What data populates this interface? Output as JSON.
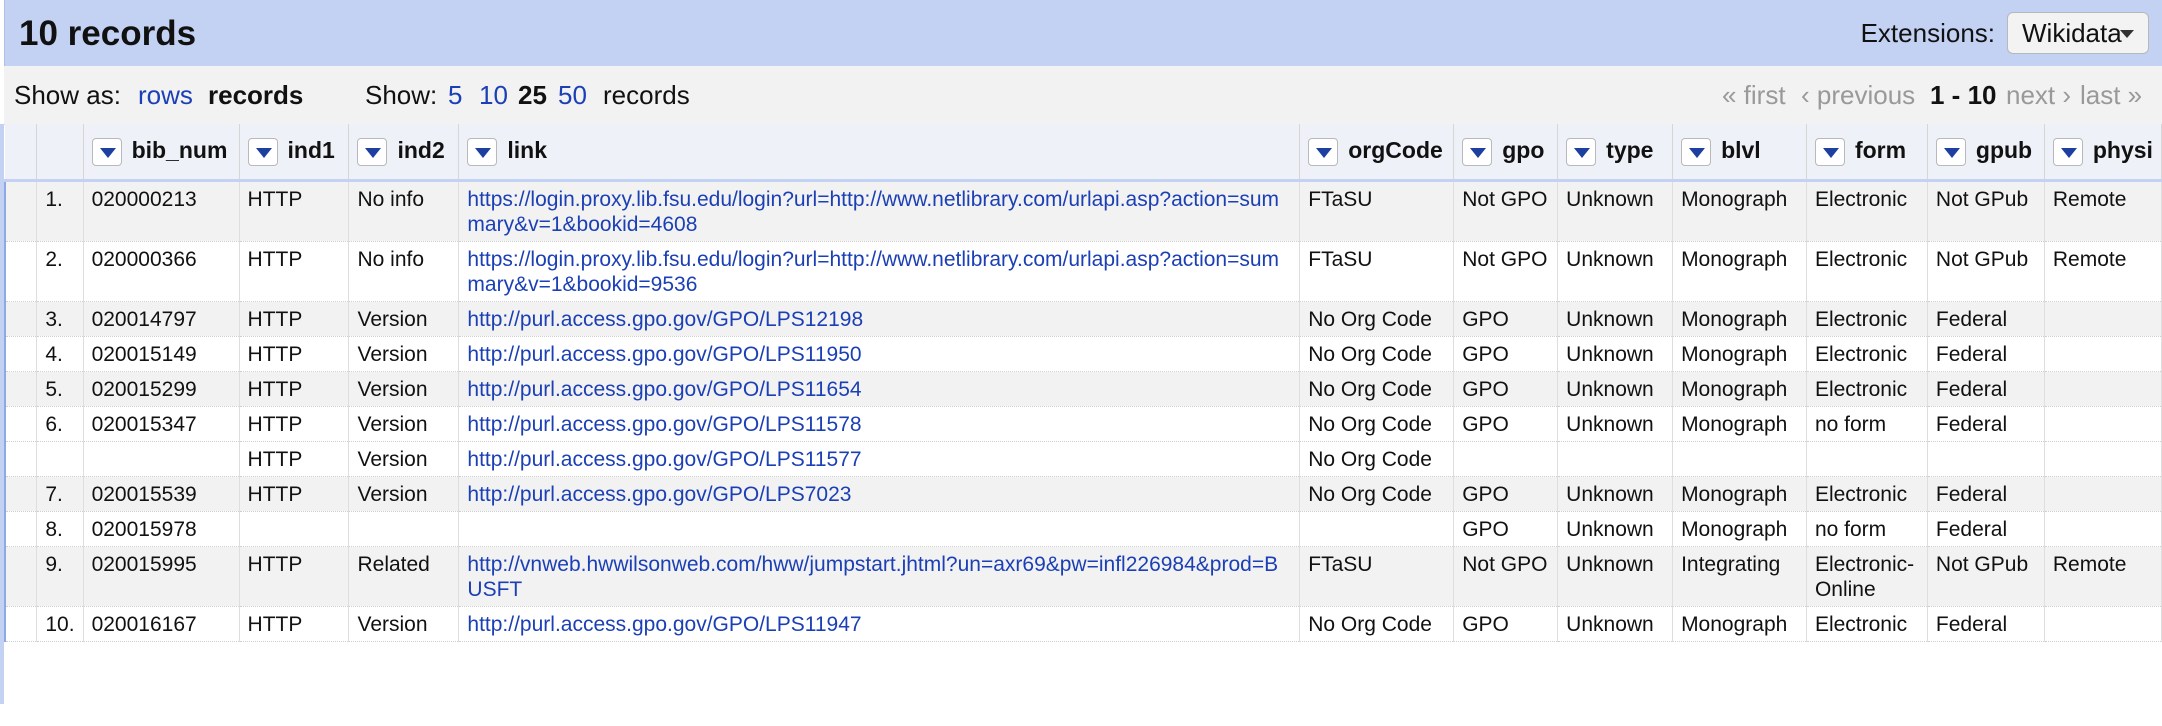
{
  "header": {
    "title": "10 records",
    "extensions_label": "Extensions:",
    "extensions_button": "Wikidata"
  },
  "toolbar": {
    "show_as_label": "Show as:",
    "rows": "rows",
    "records": "records",
    "show_label": "Show:",
    "size_5": "5",
    "size_10": "10",
    "size_25": "25",
    "size_50": "50",
    "show_suffix": "records",
    "first": "« first",
    "previous": "‹ previous",
    "range": "1 - 10",
    "next": "next ›",
    "last": "last »"
  },
  "columns": [
    "bib_num",
    "ind1",
    "ind2",
    "link",
    "orgCode",
    "gpo",
    "type",
    "blvl",
    "form",
    "gpub",
    "physi"
  ],
  "rows": [
    {
      "idx": "1.",
      "bib_num": "020000213",
      "ind1": "HTTP",
      "ind2": "No info",
      "link": "https://login.proxy.lib.fsu.edu/login?url=http://www.netlibrary.com/urlapi.asp?action=summary&v=1&bookid=4608",
      "orgCode": "FTaSU",
      "gpo": "Not GPO",
      "type": "Unknown",
      "blvl": "Monograph",
      "form": "Electronic",
      "gpub": "Not GPub",
      "physi": "Remote"
    },
    {
      "idx": "2.",
      "bib_num": "020000366",
      "ind1": "HTTP",
      "ind2": "No info",
      "link": "https://login.proxy.lib.fsu.edu/login?url=http://www.netlibrary.com/urlapi.asp?action=summary&v=1&bookid=9536",
      "orgCode": "FTaSU",
      "gpo": "Not GPO",
      "type": "Unknown",
      "blvl": "Monograph",
      "form": "Electronic",
      "gpub": "Not GPub",
      "physi": "Remote"
    },
    {
      "idx": "3.",
      "bib_num": "020014797",
      "ind1": "HTTP",
      "ind2": "Version",
      "link": "http://purl.access.gpo.gov/GPO/LPS12198",
      "orgCode": "No Org Code",
      "gpo": "GPO",
      "type": "Unknown",
      "blvl": "Monograph",
      "form": "Electronic",
      "gpub": "Federal",
      "physi": ""
    },
    {
      "idx": "4.",
      "bib_num": "020015149",
      "ind1": "HTTP",
      "ind2": "Version",
      "link": "http://purl.access.gpo.gov/GPO/LPS11950",
      "orgCode": "No Org Code",
      "gpo": "GPO",
      "type": "Unknown",
      "blvl": "Monograph",
      "form": "Electronic",
      "gpub": "Federal",
      "physi": ""
    },
    {
      "idx": "5.",
      "bib_num": "020015299",
      "ind1": "HTTP",
      "ind2": "Version",
      "link": "http://purl.access.gpo.gov/GPO/LPS11654",
      "orgCode": "No Org Code",
      "gpo": "GPO",
      "type": "Unknown",
      "blvl": "Monograph",
      "form": "Electronic",
      "gpub": "Federal",
      "physi": ""
    },
    {
      "idx": "6.",
      "bib_num": "020015347",
      "ind1": "HTTP",
      "ind2": "Version",
      "link": "http://purl.access.gpo.gov/GPO/LPS11578",
      "orgCode": "No Org Code",
      "gpo": "GPO",
      "type": "Unknown",
      "blvl": "Monograph",
      "form": "no form",
      "gpub": "Federal",
      "physi": ""
    },
    {
      "idx": "",
      "bib_num": "",
      "ind1": "HTTP",
      "ind2": "Version",
      "link": "http://purl.access.gpo.gov/GPO/LPS11577",
      "orgCode": "No Org Code",
      "gpo": "",
      "type": "",
      "blvl": "",
      "form": "",
      "gpub": "",
      "physi": ""
    },
    {
      "idx": "7.",
      "bib_num": "020015539",
      "ind1": "HTTP",
      "ind2": "Version",
      "link": "http://purl.access.gpo.gov/GPO/LPS7023",
      "orgCode": "No Org Code",
      "gpo": "GPO",
      "type": "Unknown",
      "blvl": "Monograph",
      "form": "Electronic",
      "gpub": "Federal",
      "physi": ""
    },
    {
      "idx": "8.",
      "bib_num": "020015978",
      "ind1": "",
      "ind2": "",
      "link": "",
      "orgCode": "",
      "gpo": "GPO",
      "type": "Unknown",
      "blvl": "Monograph",
      "form": "no form",
      "gpub": "Federal",
      "physi": ""
    },
    {
      "idx": "9.",
      "bib_num": "020015995",
      "ind1": "HTTP",
      "ind2": "Related",
      "link": "http://vnweb.hwwilsonweb.com/hww/jumpstart.jhtml?un=axr69&pw=infl226984&prod=BUSFT",
      "orgCode": "FTaSU",
      "gpo": "Not GPO",
      "type": "Unknown",
      "blvl": "Integrating",
      "form": "Electronic-Online",
      "gpub": "Not GPub",
      "physi": "Remote"
    },
    {
      "idx": "10.",
      "bib_num": "020016167",
      "ind1": "HTTP",
      "ind2": "Version",
      "link": "http://purl.access.gpo.gov/GPO/LPS11947",
      "orgCode": "No Org Code",
      "gpo": "GPO",
      "type": "Unknown",
      "blvl": "Monograph",
      "form": "Electronic",
      "gpub": "Federal",
      "physi": ""
    }
  ]
}
